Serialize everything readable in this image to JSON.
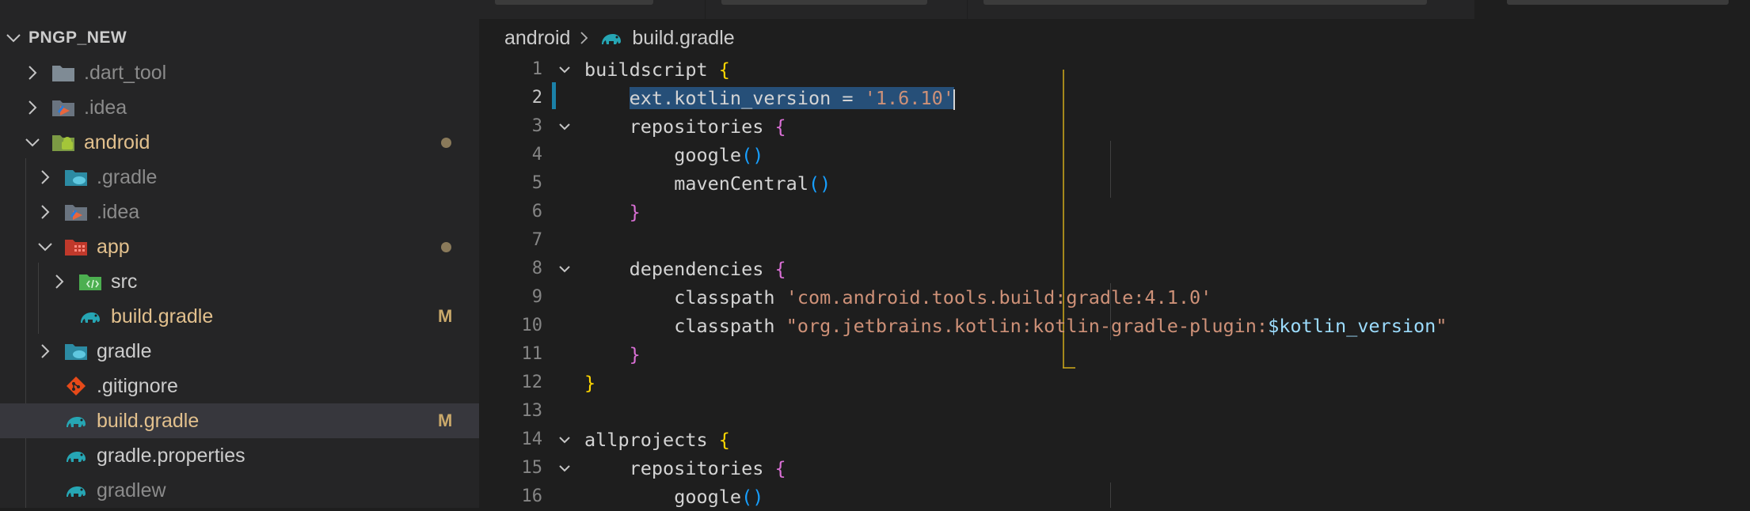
{
  "explorer": {
    "folder_name": "PNGP_NEW",
    "items": [
      {
        "label": ".dart_tool",
        "icon": "folder-icon"
      },
      {
        "label": ".idea",
        "icon": "idea-folder-icon"
      },
      {
        "label": "android",
        "icon": "android-folder-icon"
      },
      {
        "label": ".gradle",
        "icon": "gradle-folder-icon"
      },
      {
        "label": ".idea",
        "icon": "idea-folder-icon"
      },
      {
        "label": "app",
        "icon": "app-folder-icon"
      },
      {
        "label": "src",
        "icon": "src-folder-icon"
      },
      {
        "label": "build.gradle",
        "icon": "gradle-elephant-icon",
        "status": "M"
      },
      {
        "label": "gradle",
        "icon": "gradle-folder-icon"
      },
      {
        "label": ".gitignore",
        "icon": "git-icon"
      },
      {
        "label": "build.gradle",
        "icon": "gradle-elephant-icon",
        "status": "M"
      },
      {
        "label": "gradle.properties",
        "icon": "gradle-elephant-icon"
      },
      {
        "label": "gradlew",
        "icon": "gradle-elephant-icon"
      }
    ]
  },
  "breadcrumb": {
    "folder": "android",
    "file": "build.gradle"
  },
  "code": {
    "line_numbers": [
      "1",
      "2",
      "3",
      "4",
      "5",
      "6",
      "7",
      "8",
      "9",
      "10",
      "11",
      "12",
      "13",
      "14",
      "15",
      "16"
    ],
    "tokens": {
      "l1_kw": "buildscript",
      "l2_a": "ext.kotlin_version",
      "l2_eq": " = ",
      "l2_str": "'1.6.10'",
      "l3_kw": "repositories",
      "l4_fn": "google",
      "l5_fn": "mavenCentral",
      "l8_kw": "dependencies",
      "l9_kw": "classpath",
      "l9_str": "'com.android.tools.build:gradle:4.1.0'",
      "l10_kw": "classpath",
      "l10_str": "\"org.jetbrains.kotlin:kotlin-gradle-plugin:",
      "l10_var": "$kotlin_version",
      "l10_end": "\"",
      "l14_kw": "allprojects",
      "l15_kw": "repositories",
      "l16_fn": "google",
      "open_brace": "{",
      "close_brace": "}",
      "parens": "()"
    }
  },
  "colors": {
    "modified": "#e2c08d",
    "selection": "#264f78",
    "string": "#ce9178",
    "variable": "#9cdcfe"
  }
}
